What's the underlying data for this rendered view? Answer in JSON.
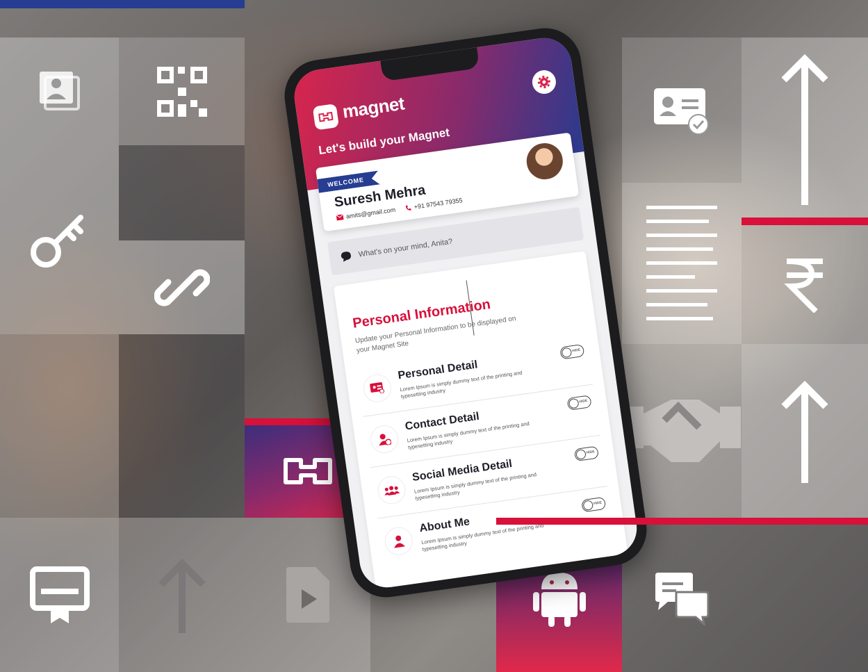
{
  "app": {
    "logo_text": "magnet",
    "tagline": "Let's build your Magnet"
  },
  "welcome": {
    "ribbon": "WELCOME",
    "name": "Suresh Mehra",
    "email": "amits@gmail.com",
    "phone": "+91 97543 79355"
  },
  "composer": {
    "placeholder": "What's on your mind, Anita?"
  },
  "info": {
    "title": "Personal Information",
    "subtitle": "Update your Personal Information to be displayed on your Magnet Site"
  },
  "sections": [
    {
      "title": "Personal Detail",
      "desc": "Lorem Ipsum is simply dummy text of the printing and typesetting industry",
      "toggle": "HIDE",
      "icon": "id-card-icon"
    },
    {
      "title": "Contact Detail",
      "desc": "Lorem Ipsum is simply dummy text of the printing and typesetting industry",
      "toggle": "HIDE",
      "icon": "contact-user-icon"
    },
    {
      "title": "Social Media Detail",
      "desc": "Lorem Ipsum is simply dummy text of the printing and typesetting industry",
      "toggle": "HIDE",
      "icon": "group-icon"
    },
    {
      "title": "About Me",
      "desc": "Lorem Ipsum is simply dummy text of the printing and typesetting industry",
      "toggle": "HIDE",
      "icon": "user-icon"
    }
  ],
  "tile_icons": [
    "photo-stack-icon",
    "qr-code-icon",
    "key-icon",
    "link-icon",
    "magnet-logo-icon",
    "certificate-icon",
    "arrow-up-icon",
    "video-file-icon",
    "android-icon",
    "chat-icon",
    "id-verified-icon",
    "document-lines-icon",
    "rupee-icon",
    "handshake-icon"
  ],
  "colors": {
    "brand_red": "#d8103a",
    "brand_blue": "#263d92",
    "brand_purple": "#8a2a6a"
  }
}
